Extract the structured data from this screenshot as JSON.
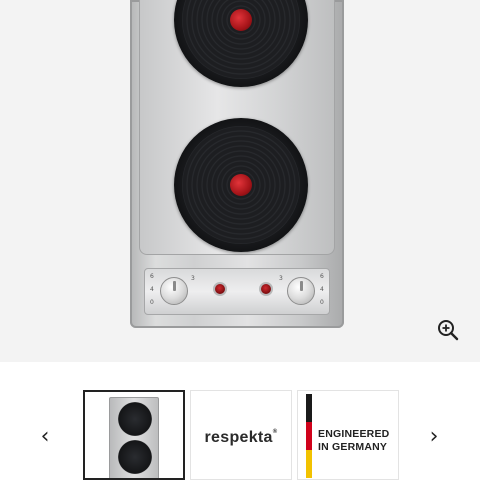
{
  "gallery": {
    "zoom_icon": "zoom-in-icon",
    "prev_icon": "chevron-left-icon",
    "next_icon": "chevron-right-icon",
    "prev_label": "‹",
    "next_label": "›",
    "active_index": 0
  },
  "panel": {
    "left_scale": [
      "6",
      "5",
      "4",
      "3",
      "2",
      "1",
      "0"
    ],
    "right_scale": [
      "6",
      "5",
      "4",
      "3",
      "2",
      "1",
      "0"
    ]
  },
  "thumbnails": [
    {
      "kind": "product-image",
      "alt": ""
    },
    {
      "kind": "brand-logo",
      "brand": "respekta",
      "mark": "®"
    },
    {
      "kind": "badge",
      "line1": "ENGINEERED",
      "line2": "IN GERMANY"
    }
  ],
  "colors": {
    "flag_black": "#1a1a1a",
    "flag_red": "#d0021b",
    "flag_gold": "#f2c200"
  }
}
